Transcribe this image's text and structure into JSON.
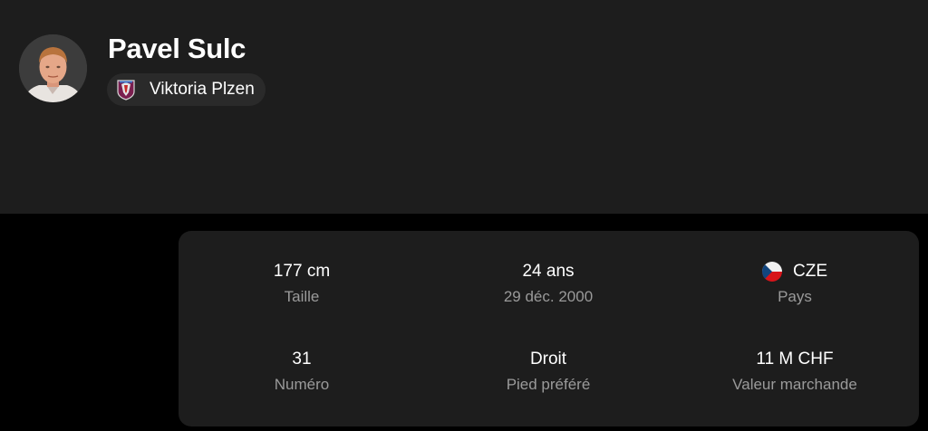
{
  "player": {
    "name": "Pavel Sulc",
    "team": "Viktoria Plzen"
  },
  "colors": {
    "page_background": "#000000",
    "card_background": "#1d1d1d",
    "chip_background": "#2a2a2a",
    "label_text": "#9a9a9a"
  },
  "icons": {
    "avatar": "player-photo",
    "team": "viktoria-plzen-crest-icon",
    "country": "czech-flag-icon"
  },
  "stats": {
    "height": {
      "value": "177 cm",
      "label": "Taille"
    },
    "age": {
      "value": "24 ans",
      "label": "29 déc. 2000"
    },
    "country": {
      "value": "CZE",
      "label": "Pays"
    },
    "number": {
      "value": "31",
      "label": "Numéro"
    },
    "foot": {
      "value": "Droit",
      "label": "Pied préféré"
    },
    "market_value": {
      "value": "11 M CHF",
      "label": "Valeur marchande"
    }
  }
}
